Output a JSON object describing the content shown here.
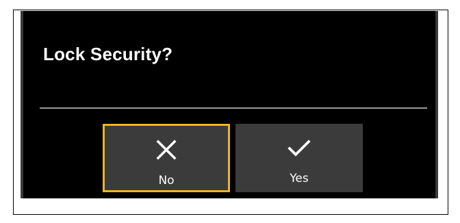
{
  "dialog": {
    "title": "Lock Security?",
    "buttons": [
      {
        "label": "No",
        "icon": "close-icon",
        "focused": true
      },
      {
        "label": "Yes",
        "icon": "check-icon",
        "focused": false
      }
    ]
  },
  "colors": {
    "background": "#000000",
    "button": "#3b3b3b",
    "focus": "#f2b61b",
    "divider": "#9b9b9b",
    "text": "#ffffff"
  }
}
